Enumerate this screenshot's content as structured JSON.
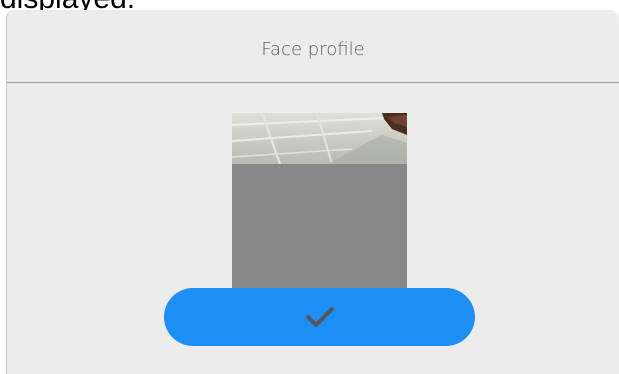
{
  "caption_fragment": "displayed.",
  "dialog": {
    "title": "Face profile"
  },
  "preview": {
    "placeholder_color": "#878787"
  },
  "confirm_button": {
    "icon": "check-icon",
    "color": "#1e8ff5"
  }
}
